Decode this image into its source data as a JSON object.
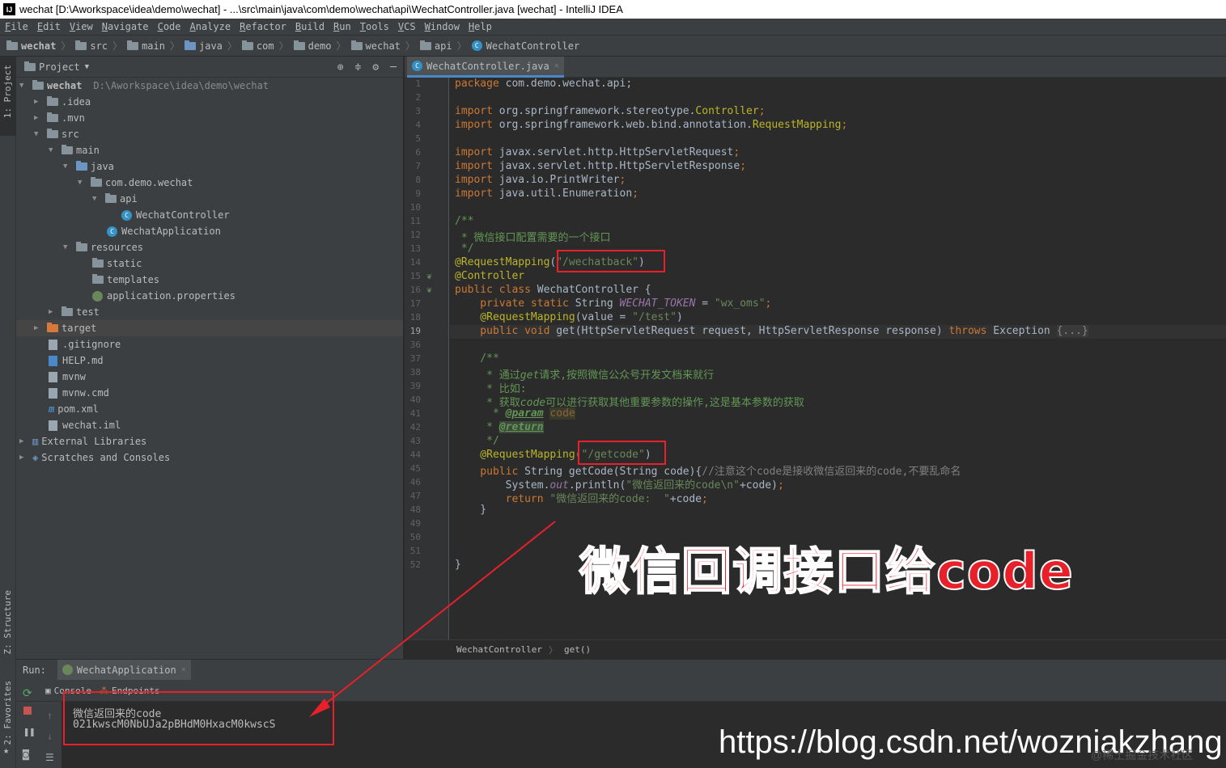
{
  "window": {
    "title": "wechat [D:\\Aworkspace\\idea\\demo\\wechat] - ...\\src\\main\\java\\com\\demo\\wechat\\api\\WechatController.java [wechat] - IntelliJ IDEA",
    "app_icon": "IJ"
  },
  "menu": [
    "File",
    "Edit",
    "View",
    "Navigate",
    "Code",
    "Analyze",
    "Refactor",
    "Build",
    "Run",
    "Tools",
    "VCS",
    "Window",
    "Help"
  ],
  "breadcrumbs": [
    "wechat",
    "src",
    "main",
    "java",
    "com",
    "demo",
    "wechat",
    "api",
    "WechatController"
  ],
  "left_stripe": {
    "project": "1: Project",
    "structure": "Z: Structure",
    "favorites": "2: Favorites"
  },
  "project_panel": {
    "title": "Project",
    "root_name": "wechat",
    "root_path": "D:\\Aworkspace\\idea\\demo\\wechat",
    "items": [
      ".idea",
      ".mvn",
      "src",
      "main",
      "java",
      "com.demo.wechat",
      "api",
      "WechatController",
      "WechatApplication",
      "resources",
      "static",
      "templates",
      "application.properties",
      "test",
      "target",
      ".gitignore",
      "HELP.md",
      "mvnw",
      "mvnw.cmd",
      "pom.xml",
      "wechat.iml",
      "External Libraries",
      "Scratches and Consoles"
    ]
  },
  "editor": {
    "tab_label": "WechatController.java",
    "line_numbers": [
      "1",
      "2",
      "3",
      "4",
      "5",
      "6",
      "7",
      "8",
      "9",
      "10",
      "11",
      "12",
      "13",
      "14",
      "15",
      "16",
      "17",
      "18",
      "19",
      "36",
      "37",
      "38",
      "39",
      "40",
      "41",
      "42",
      "43",
      "44",
      "45",
      "46",
      "47",
      "48",
      "49",
      "50",
      "51",
      "52"
    ],
    "current_line": "19",
    "code": {
      "l1a": "package",
      "l1b": " com.demo.wechat.api;",
      "l3a": "import",
      "l3b": " org.springframework.stereotype.",
      "l3c": "Controller",
      "l3d": ";",
      "l4a": "import",
      "l4b": " org.springframework.web.bind.annotation.",
      "l4c": "RequestMapping",
      "l4d": ";",
      "l6a": "import",
      "l6b": " javax.servlet.http.HttpServletRequest",
      "l6c": ";",
      "l7a": "import",
      "l7b": " javax.servlet.http.HttpServletResponse",
      "l7c": ";",
      "l8a": "import",
      "l8b": " java.io.PrintWriter",
      "l8c": ";",
      "l9a": "import",
      "l9b": " java.util.Enumeration",
      "l9c": ";",
      "l11": "/**",
      "l12": " * 微信接口配置需要的一个接口",
      "l13": " */",
      "l14a": "@RequestMapping",
      "l14b": "(",
      "l14c": "\"/wechatback\"",
      "l14d": ")",
      "l15": "@Controller",
      "l16a": "public class",
      "l16b": " WechatController {",
      "l17a": "    private static",
      "l17b": " String ",
      "l17c": "WECHAT_TOKEN",
      "l17d": " = ",
      "l17e": "\"wx_oms\"",
      "l17f": ";",
      "l18a": "    @RequestMapping",
      "l18b": "(value = ",
      "l18c": "\"/test\"",
      "l18d": ")",
      "l19a": "    public void",
      "l19b": " get(HttpServletRequest request, HttpServletResponse response) ",
      "l19c": "throws",
      "l19d": " Exception ",
      "l19e": "{...}",
      "l37": "    /**",
      "l38a": "     * 通过",
      "l38b": "get",
      "l38c": "请求,按照微信公众号开发文档来就行",
      "l39": "     * 比如:",
      "l40a": "     * 获取",
      "l40b": "code",
      "l40c": "可以进行获取其他重要参数的操作,这是基本参数的获取",
      "l41a": "      * ",
      "l41b": "@param",
      "l41c": " ",
      "l41d": "code",
      "l42a": "     * ",
      "l42b": "@return",
      "l43": "     */",
      "l44a": "    @RequestMapping",
      "l44b": "(",
      "l44c": "\"/getcode\"",
      "l44d": ")",
      "l45a": "    public",
      "l45b": " String getCode(String code){",
      "l45c": "//注意这个code是接收微信返回来的code,不要乱命名",
      "l46a": "        System.",
      "l46b": "out",
      "l46c": ".println(",
      "l46d": "\"微信返回来的code\\n\"",
      "l46e": "+code)",
      "l46f": ";",
      "l47a": "        return",
      "l47b": " \"微信返回来的code:  \"",
      "l47c": "+code",
      "l47d": ";",
      "l48": "    }",
      "l52": "}"
    },
    "status_path": [
      "WechatController",
      "get()"
    ]
  },
  "run_panel": {
    "label": "Run:",
    "config": "WechatApplication",
    "tabs": [
      "Console",
      "Endpoints"
    ],
    "output": [
      "微信返回来的code",
      "021kwscM0NbUJa2pBHdM0HxacM0kwscS"
    ]
  },
  "annotation": {
    "caption": "微信回调接口给code",
    "color": "#e8202a"
  },
  "watermark": {
    "url": "https://blog.csdn.net/wozniakzhang",
    "faint": "@稀土掘金技术社区"
  },
  "colors": {
    "keyword": "#cc7832",
    "annotation": "#bbb529",
    "string": "#6a8759",
    "doc_comment": "#629755",
    "accent_blue": "#4a88c7"
  }
}
